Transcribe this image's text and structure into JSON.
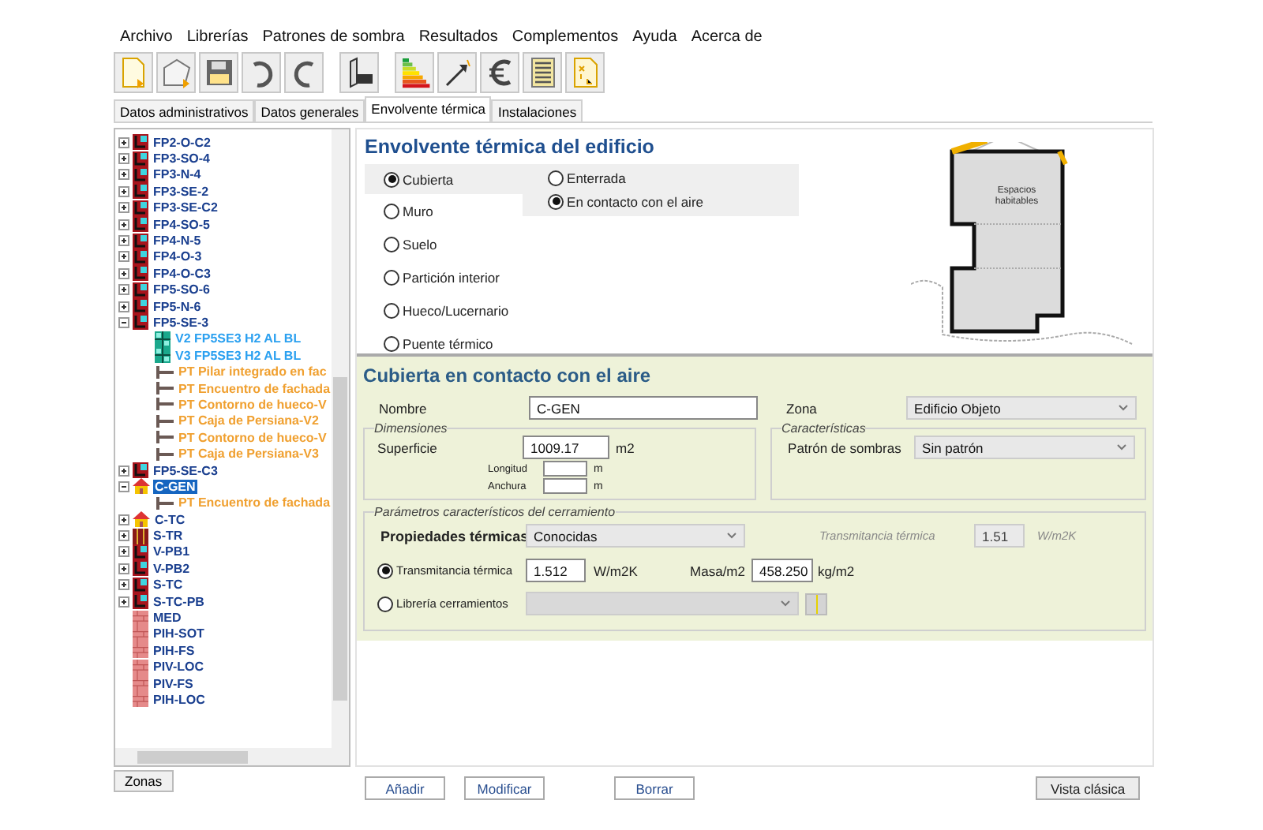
{
  "menu": [
    "Archivo",
    "Librerías",
    "Patrones de sombra",
    "Resultados",
    "Complementos",
    "Ayuda",
    "Acerca de"
  ],
  "tabs": [
    {
      "label": "Datos administrativos",
      "selected": false
    },
    {
      "label": "Datos generales",
      "selected": false
    },
    {
      "label": "Envolvente térmica",
      "selected": true
    },
    {
      "label": "Instalaciones",
      "selected": false
    }
  ],
  "tree": [
    {
      "kind": "wall",
      "label": "FP2-O-C2",
      "expanded": false,
      "selected": false
    },
    {
      "kind": "wall",
      "label": "FP3-SO-4",
      "expanded": false,
      "selected": false
    },
    {
      "kind": "wall",
      "label": "FP3-N-4",
      "expanded": false,
      "selected": false
    },
    {
      "kind": "wall",
      "label": "FP3-SE-2",
      "expanded": false,
      "selected": false
    },
    {
      "kind": "wall",
      "label": "FP3-SE-C2",
      "expanded": false,
      "selected": false
    },
    {
      "kind": "wall",
      "label": "FP4-SO-5",
      "expanded": false,
      "selected": false
    },
    {
      "kind": "wall",
      "label": "FP4-N-5",
      "expanded": false,
      "selected": false
    },
    {
      "kind": "wall",
      "label": "FP4-O-3",
      "expanded": false,
      "selected": false
    },
    {
      "kind": "wall",
      "label": "FP4-O-C3",
      "expanded": false,
      "selected": false
    },
    {
      "kind": "wall",
      "label": "FP5-SO-6",
      "expanded": false,
      "selected": false
    },
    {
      "kind": "wall",
      "label": "FP5-N-6",
      "expanded": false,
      "selected": false
    },
    {
      "kind": "wall",
      "label": "FP5-SE-3",
      "expanded": true,
      "selected": false,
      "children": [
        {
          "kind": "window",
          "label": "V2 FP5SE3 H2 AL BL",
          "selected": false
        },
        {
          "kind": "window",
          "label": "V3 FP5SE3 H2 AL BL",
          "selected": false
        },
        {
          "kind": "bridge",
          "label": "PT Pilar integrado en fac",
          "selected": false
        },
        {
          "kind": "bridge",
          "label": "PT Encuentro de fachada",
          "selected": false
        },
        {
          "kind": "bridge",
          "label": "PT Contorno de hueco-V",
          "selected": false
        },
        {
          "kind": "bridge",
          "label": "PT Caja de Persiana-V2",
          "selected": false
        },
        {
          "kind": "bridge",
          "label": "PT Contorno de hueco-V",
          "selected": false
        },
        {
          "kind": "bridge",
          "label": "PT Caja de Persiana-V3",
          "selected": false
        }
      ]
    },
    {
      "kind": "wall",
      "label": "FP5-SE-C3",
      "expanded": false,
      "selected": false
    },
    {
      "kind": "zone",
      "label": "C-GEN",
      "expanded": true,
      "selected": true,
      "children": [
        {
          "kind": "bridge",
          "label": "PT Encuentro de fachada",
          "selected": false
        }
      ]
    },
    {
      "kind": "zone",
      "label": "C-TC",
      "expanded": false,
      "selected": false
    },
    {
      "kind": "floor",
      "label": "S-TR",
      "expanded": false,
      "selected": false
    },
    {
      "kind": "wall",
      "label": "V-PB1",
      "expanded": false,
      "selected": false
    },
    {
      "kind": "wall",
      "label": "V-PB2",
      "expanded": false,
      "selected": false
    },
    {
      "kind": "wall",
      "label": "S-TC",
      "expanded": false,
      "selected": false
    },
    {
      "kind": "wall",
      "label": "S-TC-PB",
      "expanded": false,
      "selected": false
    },
    {
      "kind": "partition",
      "label": "MED",
      "selected": false
    },
    {
      "kind": "partition",
      "label": "PIH-SOT",
      "selected": false
    },
    {
      "kind": "partition",
      "label": "PIH-FS",
      "selected": false
    },
    {
      "kind": "partition",
      "label": "PIV-LOC",
      "selected": false
    },
    {
      "kind": "partition",
      "label": "PIV-FS",
      "selected": false
    },
    {
      "kind": "partition",
      "label": "PIH-LOC",
      "selected": false
    }
  ],
  "tree_tab": "Zonas",
  "section_title": "Envolvente térmica del edificio",
  "element_types": [
    {
      "label": "Cubierta",
      "selected": true
    },
    {
      "label": "Muro",
      "selected": false
    },
    {
      "label": "Suelo",
      "selected": false
    },
    {
      "label": "Partición interior",
      "selected": false
    },
    {
      "label": "Hueco/Lucernario",
      "selected": false
    },
    {
      "label": "Puente térmico",
      "selected": false
    }
  ],
  "subtypes": [
    {
      "label": "Enterrada",
      "selected": false
    },
    {
      "label": "En contacto con el aire",
      "selected": true
    }
  ],
  "diagram_label": "Espacios habitables",
  "detail": {
    "title": "Cubierta en contacto con el aire",
    "nombre": {
      "label": "Nombre",
      "value": "C-GEN"
    },
    "zona": {
      "label": "Zona",
      "value": "Edificio Objeto"
    },
    "dimensiones": {
      "legend": "Dimensiones",
      "superficie": {
        "label": "Superficie",
        "value": "1009.17",
        "unit": "m2"
      },
      "longitud": {
        "label": "Longitud",
        "unit": "m"
      },
      "anchura": {
        "label": "Anchura",
        "unit": "m"
      }
    },
    "caracteristicas": {
      "legend": "Características",
      "patron": {
        "label": "Patrón de sombras",
        "value": "Sin patrón"
      }
    },
    "parametros": {
      "legend": "Parámetros característicos del cerramiento",
      "propiedades": {
        "label": "Propiedades térmicas",
        "value": "Conocidas"
      },
      "referencia": {
        "label": "Transmitancia térmica",
        "value": "1.51",
        "unit": "W/m2K"
      },
      "options": [
        {
          "kind": "values",
          "label": "Transmitancia térmica",
          "selected": true,
          "value": "1.512",
          "unit": "W/m2K",
          "mass_label": "Masa/m2",
          "mass_value": "458.250",
          "mass_unit": "kg/m2"
        },
        {
          "kind": "library",
          "label": "Librería cerramientos",
          "selected": false
        }
      ]
    }
  },
  "buttons": [
    {
      "label": "Añadir",
      "kind": "left"
    },
    {
      "label": "Modificar",
      "kind": "left"
    },
    {
      "label": "Borrar",
      "kind": "middle"
    },
    {
      "label": "Vista clásica",
      "kind": "right"
    }
  ]
}
